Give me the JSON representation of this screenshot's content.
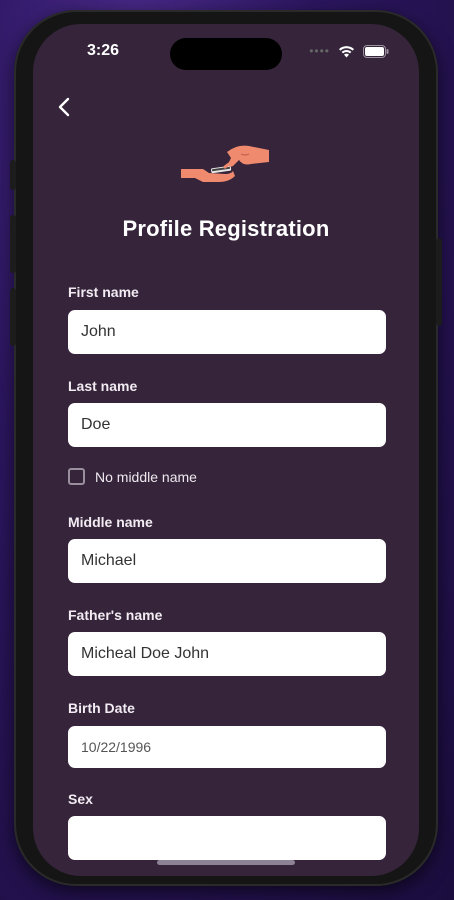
{
  "status_bar": {
    "time": "3:26"
  },
  "header": {
    "title": "Profile Registration"
  },
  "icons": {
    "back": "chevron-left-icon",
    "illustration": "hand-giving-card-icon",
    "wifi": "wifi-icon",
    "battery": "battery-icon"
  },
  "form": {
    "first_name": {
      "label": "First name",
      "value": "John"
    },
    "last_name": {
      "label": "Last name",
      "value": "Doe"
    },
    "no_middle_name": {
      "label": "No middle name",
      "checked": false
    },
    "middle_name": {
      "label": "Middle name",
      "value": "Michael"
    },
    "fathers_name": {
      "label": "Father's name",
      "value": "Micheal Doe John"
    },
    "birth_date": {
      "label": "Birth Date",
      "value": "10/22/1996"
    },
    "sex": {
      "label": "Sex",
      "value": ""
    }
  },
  "colors": {
    "screen_background": "#35243a",
    "illustration_accent": "#f08a6e",
    "field_background": "#ffffff"
  }
}
